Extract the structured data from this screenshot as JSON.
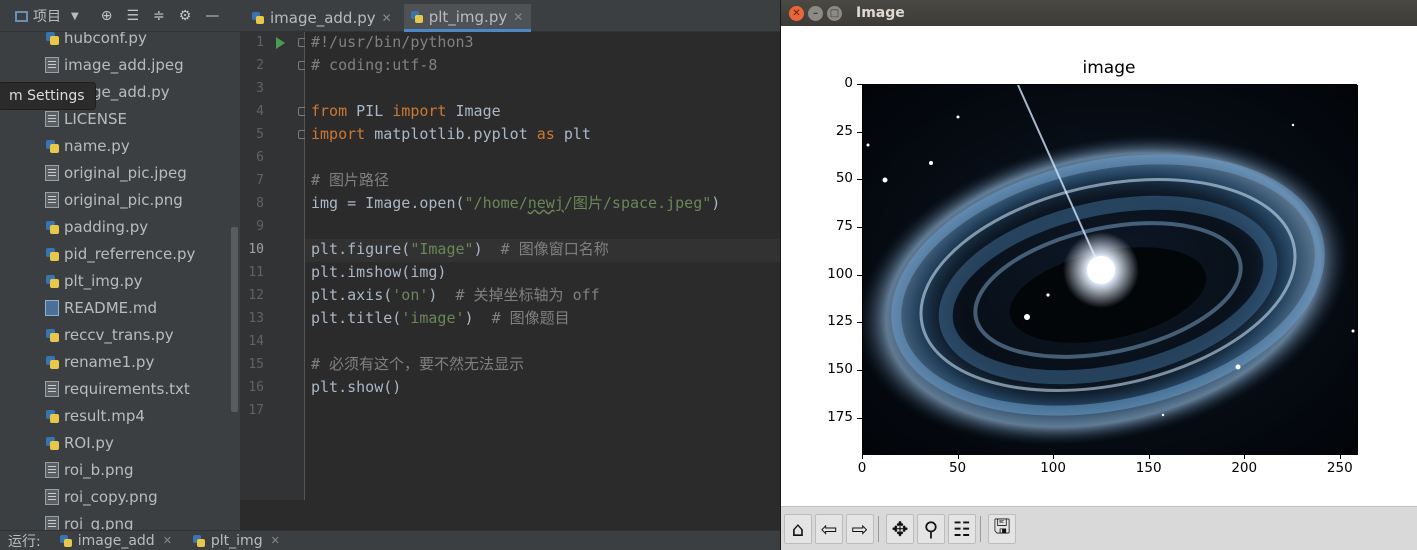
{
  "ide": {
    "project_label": "项目",
    "tabs": [
      {
        "label": "image_add.py",
        "active": false
      },
      {
        "label": "plt_img.py",
        "active": true
      }
    ],
    "tooltip": "m Settings",
    "files": [
      {
        "name": "hubconf.py",
        "type": "py"
      },
      {
        "name": "image_add.jpeg",
        "type": "doc"
      },
      {
        "name": "image_add.py",
        "type": "py"
      },
      {
        "name": "LICENSE",
        "type": "doc"
      },
      {
        "name": "name.py",
        "type": "py"
      },
      {
        "name": "original_pic.jpeg",
        "type": "doc"
      },
      {
        "name": "original_pic.png",
        "type": "doc"
      },
      {
        "name": "padding.py",
        "type": "py"
      },
      {
        "name": "pid_referrence.py",
        "type": "py"
      },
      {
        "name": "plt_img.py",
        "type": "py"
      },
      {
        "name": "README.md",
        "type": "md"
      },
      {
        "name": "reccv_trans.py",
        "type": "py"
      },
      {
        "name": "rename1.py",
        "type": "py"
      },
      {
        "name": "requirements.txt",
        "type": "doc"
      },
      {
        "name": "result.mp4",
        "type": "py"
      },
      {
        "name": "ROI.py",
        "type": "py"
      },
      {
        "name": "roi_b.png",
        "type": "doc"
      },
      {
        "name": "roi_copy.png",
        "type": "doc"
      },
      {
        "name": "roi_g.png",
        "type": "doc"
      }
    ],
    "line_numbers": [
      "1",
      "2",
      "3",
      "4",
      "5",
      "6",
      "7",
      "8",
      "9",
      "10",
      "11",
      "12",
      "13",
      "14",
      "15",
      "16",
      "17"
    ],
    "current_line": "10",
    "code_lines": [
      [
        {
          "t": "#!/usr/bin/python3",
          "c": "com"
        }
      ],
      [
        {
          "t": "# coding:utf-8",
          "c": "com"
        }
      ],
      [],
      [
        {
          "t": "from",
          "c": "kw"
        },
        {
          "t": " PIL ",
          "c": ""
        },
        {
          "t": "import",
          "c": "kw"
        },
        {
          "t": " Image",
          "c": ""
        }
      ],
      [
        {
          "t": "import",
          "c": "kw"
        },
        {
          "t": " matplotlib.pyplot ",
          "c": ""
        },
        {
          "t": "as",
          "c": "kw"
        },
        {
          "t": " plt",
          "c": ""
        }
      ],
      [],
      [
        {
          "t": "# 图片路径",
          "c": "com"
        }
      ],
      [
        {
          "t": "img = Image.open(",
          "c": ""
        },
        {
          "t": "\"/home/",
          "c": "str"
        },
        {
          "t": "newj",
          "c": "str uline"
        },
        {
          "t": "/图片/space.jpeg\"",
          "c": "str"
        },
        {
          "t": ")",
          "c": ""
        }
      ],
      [],
      [
        {
          "t": "plt.figure(",
          "c": ""
        },
        {
          "t": "\"Image\"",
          "c": "str"
        },
        {
          "t": ")  ",
          "c": ""
        },
        {
          "t": "# 图像窗口名称",
          "c": "com"
        }
      ],
      [
        {
          "t": "plt.imshow(img)",
          "c": ""
        }
      ],
      [
        {
          "t": "plt.axis(",
          "c": ""
        },
        {
          "t": "'on'",
          "c": "str"
        },
        {
          "t": ")  ",
          "c": ""
        },
        {
          "t": "# 关掉坐标轴为 off",
          "c": "com"
        }
      ],
      [
        {
          "t": "plt.title(",
          "c": ""
        },
        {
          "t": "'image'",
          "c": "str"
        },
        {
          "t": ")  ",
          "c": ""
        },
        {
          "t": "# 图像题目",
          "c": "com"
        }
      ],
      [],
      [
        {
          "t": "# 必须有这个，要不然无法显示",
          "c": "com"
        }
      ],
      [
        {
          "t": "plt.show()",
          "c": ""
        }
      ],
      []
    ],
    "run_label": "运行:",
    "run_tabs": [
      "image_add",
      "plt_img"
    ]
  },
  "image_window": {
    "title": "Image",
    "plot_title": "image",
    "y_ticks": [
      "0",
      "25",
      "50",
      "75",
      "100",
      "125",
      "150",
      "175"
    ],
    "x_ticks": [
      "0",
      "50",
      "100",
      "150",
      "200",
      "250"
    ],
    "toolbar_icons": [
      "home-icon",
      "back-icon",
      "forward-icon",
      "pan-icon",
      "zoom-icon",
      "configure-icon",
      "save-icon"
    ]
  }
}
